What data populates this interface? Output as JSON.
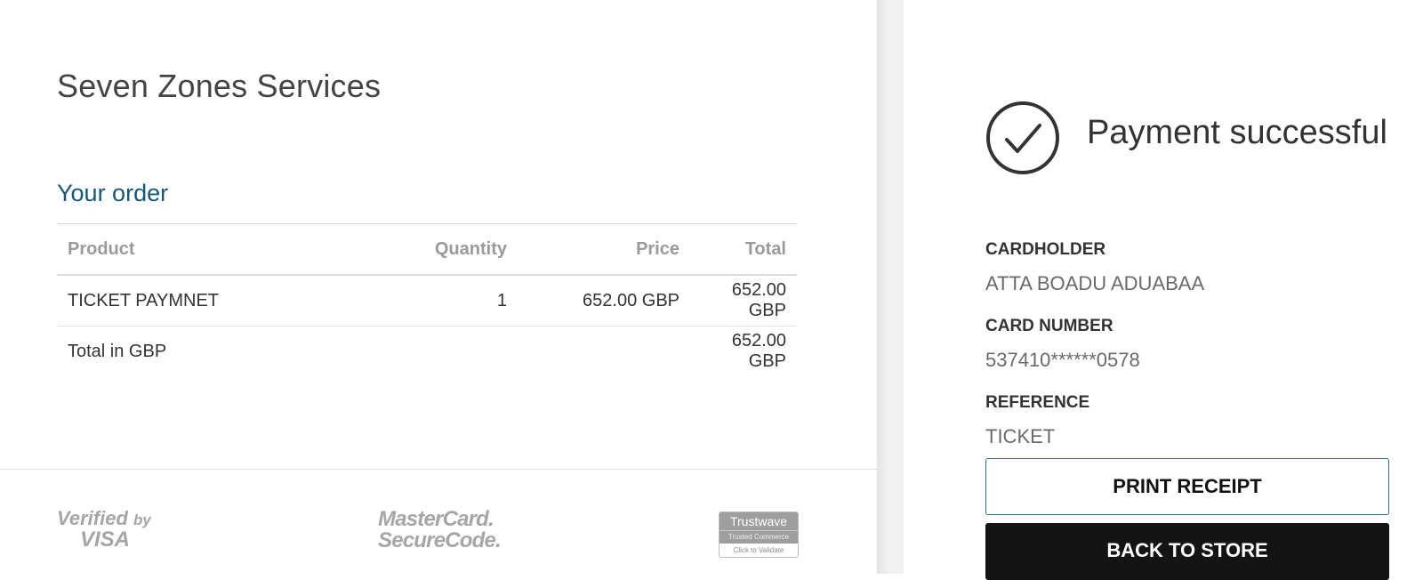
{
  "merchant": {
    "name": "Seven Zones Services"
  },
  "order": {
    "heading": "Your order",
    "columns": {
      "product": "Product",
      "quantity": "Quantity",
      "price": "Price",
      "total": "Total"
    },
    "items": [
      {
        "product": "TICKET PAYMNET",
        "quantity": "1",
        "price": "652.00 GBP",
        "total": "652.00 GBP"
      }
    ],
    "total_label": "Total in GBP",
    "total_value": "652.00 GBP"
  },
  "footer": {
    "verified_by_visa": {
      "line1": "Verified",
      "line1_small": "by",
      "line2": "VISA"
    },
    "mastercard": {
      "line1": "MasterCard.",
      "line2": "SecureCode."
    },
    "trustwave": {
      "brand": "Trustwave",
      "sub": "Trusted Commerce",
      "action": "Click to Validate"
    }
  },
  "status": {
    "icon": "check-circle-icon",
    "message": "Payment successful"
  },
  "details": {
    "cardholder_label": "CARDHOLDER",
    "cardholder_value": "ATTA BOADU ADUABAA",
    "card_number_label": "CARD NUMBER",
    "card_number_value": "537410******0578",
    "reference_label": "REFERENCE",
    "reference_value": "TICKET"
  },
  "actions": {
    "print_label": "PRINT RECEIPT",
    "back_label": "BACK TO STORE"
  },
  "colors": {
    "heading_accent": "#15577a",
    "button_border": "#2a6f93",
    "button_dark": "#141414"
  }
}
